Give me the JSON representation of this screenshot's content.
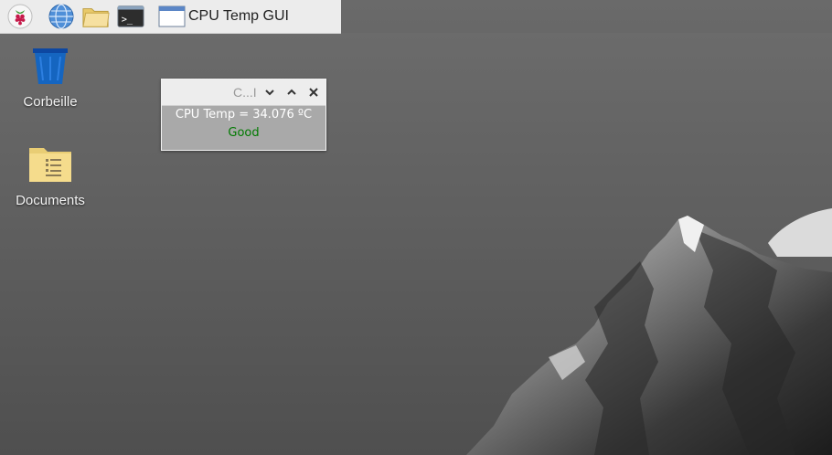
{
  "taskbar": {
    "launchers": [
      "raspberry-menu",
      "web-browser",
      "file-manager",
      "terminal"
    ],
    "active_task": {
      "title": "CPU Temp GUI"
    }
  },
  "desktop": {
    "icons": [
      {
        "label": "Corbeille",
        "icon": "trash-icon"
      },
      {
        "label": "Documents",
        "icon": "folder-icon"
      }
    ]
  },
  "app_window": {
    "title": "C...I",
    "temp_text": "CPU Temp = 34.076 ºC",
    "status_text": "Good",
    "status_color": "#007a00"
  },
  "colors": {
    "taskbar_bg": "#ececec",
    "trash_blue": "#1565c0",
    "folder_yellow": "#f5dc8c"
  }
}
